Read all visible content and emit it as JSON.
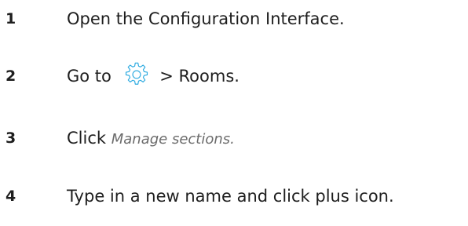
{
  "steps": [
    {
      "number": "1",
      "text": "Open the Configuration Interface."
    },
    {
      "number": "2",
      "prefix": "Go to",
      "icon": "gear-icon",
      "suffix": "> Rooms."
    },
    {
      "number": "3",
      "text": "Click",
      "emphasis": "Manage sections."
    },
    {
      "number": "4",
      "text": "Type in a new name and click plus icon."
    }
  ],
  "colors": {
    "text": "#1e1e1e",
    "emphasis": "#6b6b6b",
    "icon": "#29a9e0"
  }
}
